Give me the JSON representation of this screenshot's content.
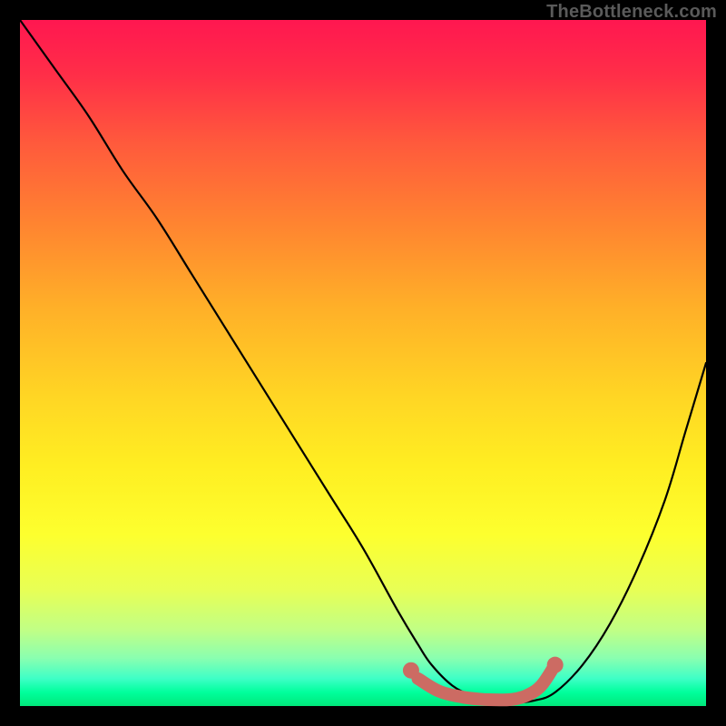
{
  "credit": "TheBottleneck.com",
  "chart_data": {
    "type": "line",
    "title": "",
    "xlabel": "",
    "ylabel": "",
    "xlim": [
      0,
      100
    ],
    "ylim": [
      0,
      100
    ],
    "series": [
      {
        "name": "curve",
        "x": [
          0,
          5,
          10,
          15,
          20,
          25,
          30,
          35,
          40,
          45,
          50,
          55,
          58,
          60,
          63,
          66,
          69,
          72,
          75,
          78,
          82,
          86,
          90,
          94,
          97,
          100
        ],
        "values": [
          100,
          93,
          86,
          78,
          71,
          63,
          55,
          47,
          39,
          31,
          23,
          14,
          9,
          6,
          3,
          1.5,
          0.8,
          0.5,
          0.8,
          2,
          6,
          12,
          20,
          30,
          40,
          50
        ]
      }
    ],
    "highlight": {
      "name": "flat-segment",
      "color": "#cc6b63",
      "x": [
        58,
        61,
        64,
        67,
        70,
        72,
        74,
        76,
        78
      ],
      "values": [
        4.0,
        2.2,
        1.4,
        1.0,
        0.9,
        1.0,
        1.6,
        3.0,
        6.0
      ],
      "endpoints": [
        {
          "x": 57,
          "value": 5.2
        },
        {
          "x": 78,
          "value": 6.0
        }
      ]
    }
  }
}
